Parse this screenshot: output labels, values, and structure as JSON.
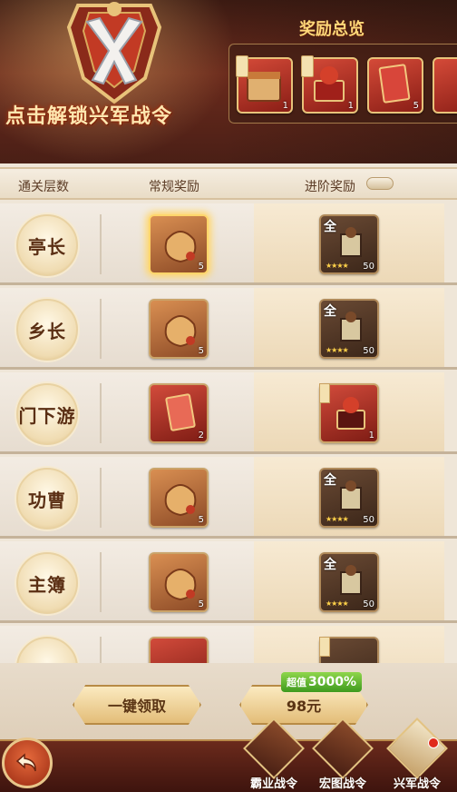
{
  "header": {
    "unlock_label": "点击解锁兴军战令",
    "overview_title": "奖励总览",
    "overview_items": [
      {
        "count": "1",
        "kind": "red",
        "self_select": true
      },
      {
        "count": "1",
        "kind": "red",
        "self_select": true
      },
      {
        "count": "5",
        "kind": "red",
        "self_select": false
      },
      {
        "count": "",
        "kind": "red",
        "self_select": false
      }
    ]
  },
  "columns": {
    "level": "通关层数",
    "normal": "常规奖励",
    "advanced": "进阶奖励"
  },
  "rows": [
    {
      "rank": "亭长",
      "normal": {
        "count": "5",
        "kind": "gold",
        "glow": true
      },
      "advanced": {
        "count": "50",
        "kind": "brown",
        "quan": "全",
        "stars": "★★★★"
      }
    },
    {
      "rank": "乡长",
      "normal": {
        "count": "5",
        "kind": "gold",
        "glow": false
      },
      "advanced": {
        "count": "50",
        "kind": "brown",
        "quan": "全",
        "stars": "★★★★"
      }
    },
    {
      "rank": "门下游",
      "normal": {
        "count": "2",
        "kind": "red",
        "glow": false
      },
      "advanced": {
        "count": "1",
        "kind": "red",
        "quan": "",
        "stars": ""
      }
    },
    {
      "rank": "功曹",
      "normal": {
        "count": "5",
        "kind": "gold",
        "glow": false
      },
      "advanced": {
        "count": "50",
        "kind": "brown",
        "quan": "全",
        "stars": "★★★★"
      }
    },
    {
      "rank": "主簿",
      "normal": {
        "count": "5",
        "kind": "gold",
        "glow": false
      },
      "advanced": {
        "count": "50",
        "kind": "brown",
        "quan": "全",
        "stars": "★★★★"
      }
    }
  ],
  "footer": {
    "claim_all": "一键领取",
    "deal_prefix": "超值",
    "deal_value": "3000%",
    "price": "98元"
  },
  "tabs": [
    {
      "label": "霸业战令"
    },
    {
      "label": "宏图战令"
    },
    {
      "label": "兴军战令"
    }
  ],
  "colors": {
    "accent_red": "#8a1e16",
    "gold": "#e3bd78",
    "deal_green": "#3e9a1e"
  }
}
